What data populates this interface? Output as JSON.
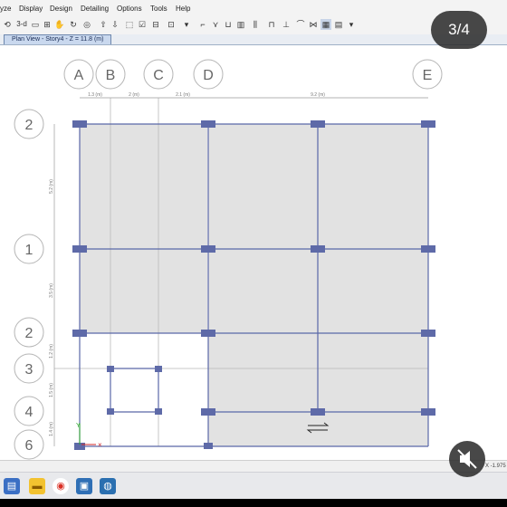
{
  "menu": {
    "items": [
      "yze",
      "Display",
      "Design",
      "Detailing",
      "Options",
      "Tools",
      "Help"
    ]
  },
  "toolbar": {
    "text_3d": "3-d",
    "icons": [
      "rotate-icon",
      "pan-icon",
      "view-3d-icon",
      "plan-icon",
      "elevation-icon",
      "refresh-icon",
      "move-up-icon",
      "move-down-icon",
      "select-icon",
      "checkbox-icon",
      "object-shrink-icon",
      "display-options-icon",
      "draw-frame-icon",
      "draw-brace-icon",
      "draw-wall-icon",
      "draw-slab-icon",
      "draw-column-icon",
      "draw-beam-icon",
      "section-cut-icon",
      "snap-icon",
      "grid-icon",
      "dropdown-icon"
    ]
  },
  "tab": {
    "label": "Plan View - Story4 - Z = 11.8 (m)"
  },
  "grid": {
    "x_bubbles": [
      "A",
      "B",
      "C",
      "D",
      "E"
    ],
    "x_dimensions": [
      "1.3 (m)",
      "2 (m)",
      "2.1 (m)",
      "9.2 (m)"
    ],
    "y_bubbles": [
      "2",
      "1",
      "2",
      "3",
      "4",
      "6"
    ],
    "y_dimensions": [
      "5.2 (m)",
      "3.5 (m)",
      "1.2 (m)",
      "1.5 (m)",
      "1.4 (m)"
    ]
  },
  "status": {
    "coord": "X -1.975"
  },
  "overlay": {
    "pager": "3/4"
  },
  "colors": {
    "slab": "#e2e2e2",
    "column": "#5e6aa8",
    "beam": "#5a68a8",
    "tab_accent": "#6d87ad"
  }
}
